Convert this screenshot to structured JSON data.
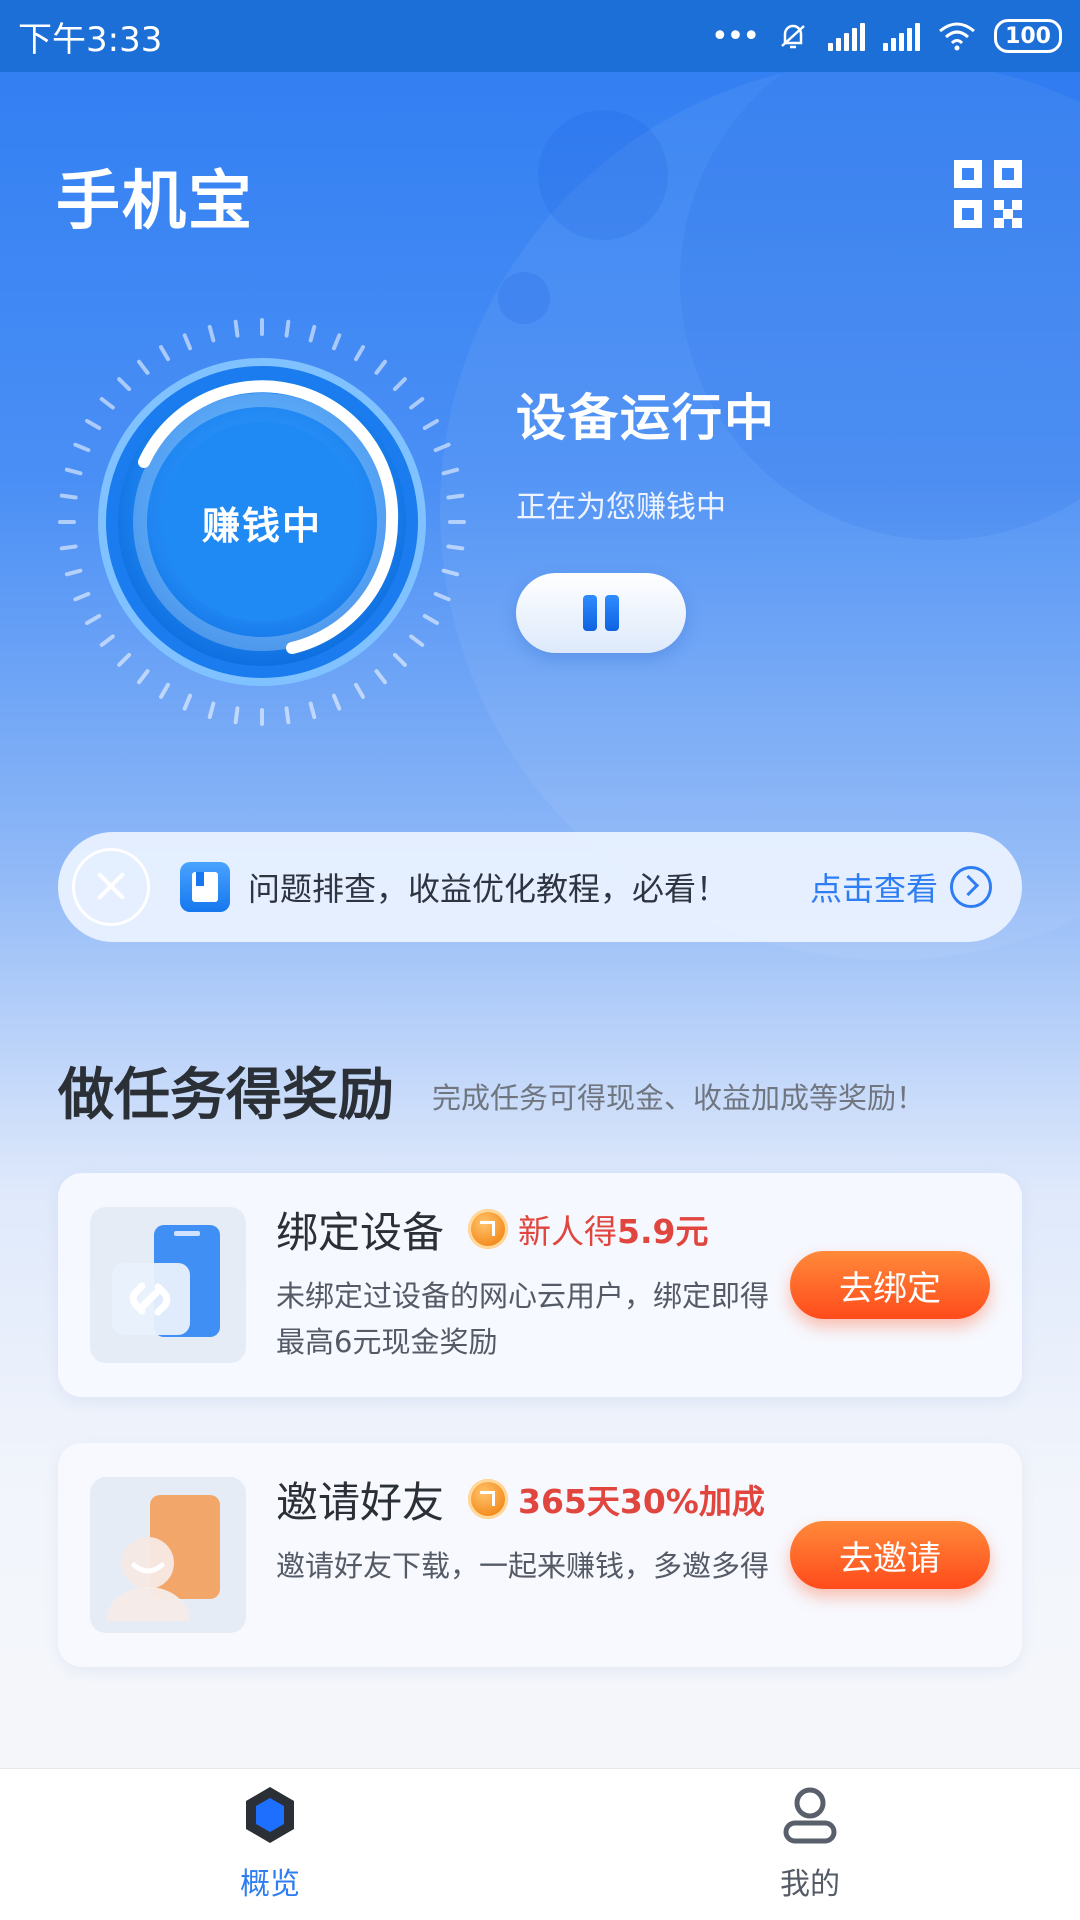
{
  "status_bar": {
    "time": "下午3:33",
    "battery": "100",
    "icons": [
      "more-dots-icon",
      "bell-off-icon",
      "signal-icon",
      "hd-signal-icon",
      "wifi-icon",
      "battery-icon"
    ]
  },
  "header": {
    "app_title": "手机宝",
    "qr_icon": "qr-code-icon"
  },
  "status_panel": {
    "dial_label": "赚钱中",
    "title": "设备运行中",
    "subtitle": "正在为您赚钱中",
    "pause_icon": "pause-icon"
  },
  "notice": {
    "text": "问题排查，收益优化教程，必看！",
    "link": "点击查看",
    "close_icon": "close-icon",
    "book_icon": "book-icon",
    "arrow_icon": "chevron-right-circle-icon"
  },
  "tasks": {
    "title": "做任务得奖励",
    "subtitle": "完成任务可得现金、收益加成等奖励！",
    "items": [
      {
        "name": "绑定设备",
        "reward_prefix": "新人得",
        "reward_value": "5.9元",
        "description": "未绑定过设备的网心云用户，绑定即得最高6元现金奖励",
        "button": "去绑定",
        "thumb_icon": "phone-link-icon"
      },
      {
        "name": "邀请好友",
        "reward_prefix": "",
        "reward_value": "365天30%加成",
        "description": "邀请好友下载，一起来赚钱，多邀多得",
        "button": "去邀请",
        "thumb_icon": "user-card-icon"
      }
    ]
  },
  "tabbar": {
    "tabs": [
      {
        "label": "概览",
        "icon": "hexagon-icon",
        "active": true
      },
      {
        "label": "我的",
        "icon": "user-icon",
        "active": false
      }
    ]
  },
  "colors": {
    "primary_blue": "#2f7df2",
    "reward_red": "#e0463e",
    "button_orange": "#ff5a22"
  }
}
